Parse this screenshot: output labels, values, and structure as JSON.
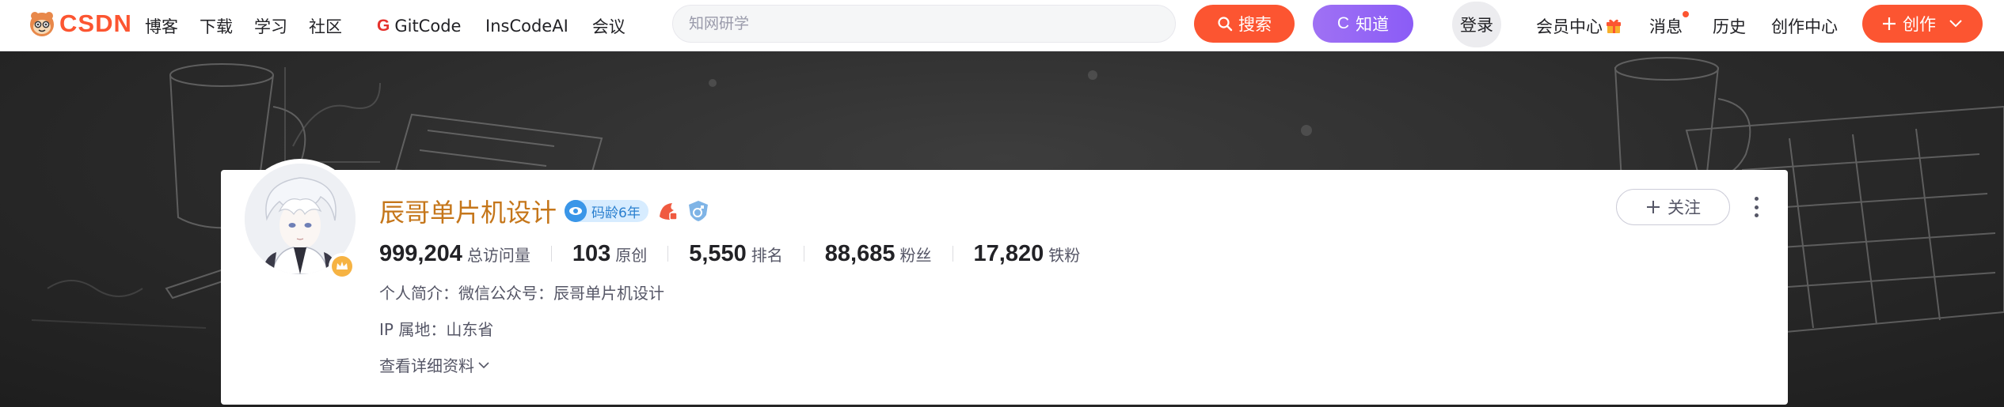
{
  "logo": {
    "text": "CSDN"
  },
  "nav": [
    "博客",
    "下载",
    "学习",
    "社区"
  ],
  "gitcode": {
    "label": "GitCode"
  },
  "nav2": [
    "InsCodeAI",
    "会议"
  ],
  "search": {
    "placeholder": "知网研学",
    "button": "搜索"
  },
  "zhidao": {
    "icon_letter": "C",
    "label": "知道"
  },
  "login": "登录",
  "right_nav": {
    "vip": "会员中心",
    "messages": "消息",
    "history": "历史",
    "creator": "创作中心"
  },
  "create_button": "创作",
  "profile": {
    "name": "辰哥单片机设计",
    "code_age": "码龄6年",
    "stats": [
      {
        "value": "999,204",
        "label": "总访问量"
      },
      {
        "value": "103",
        "label": "原创"
      },
      {
        "value": "5,550",
        "label": "排名"
      },
      {
        "value": "88,685",
        "label": "粉丝"
      },
      {
        "value": "17,820",
        "label": "铁粉"
      }
    ],
    "intro": "个人简介：微信公众号：辰哥单片机设计",
    "ip": "IP 属地：山东省",
    "more": "查看详细资料",
    "follow": "关注"
  },
  "colors": {
    "brand": "#fc5531",
    "zhidao": "#8b5cf6",
    "name": "#c5761a",
    "code_age_badge": "#d7ecff"
  },
  "icons": [
    "search-icon",
    "gift-icon",
    "plus-icon",
    "chevron-down-icon",
    "crown-icon",
    "more-icon"
  ]
}
